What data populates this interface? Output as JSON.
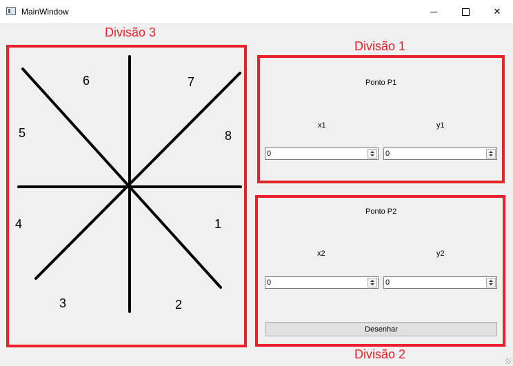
{
  "window": {
    "title": "MainWindow",
    "min_icon": "minimize-icon",
    "max_icon": "maximize-icon",
    "close_icon": "close-icon",
    "close_glyph": "✕"
  },
  "annotations": {
    "div3": "Divisão 3",
    "div1": "Divisão 1",
    "div2": "Divisão 2",
    "color": "#e8232b"
  },
  "octants": {
    "o1": "1",
    "o2": "2",
    "o3": "3",
    "o4": "4",
    "o5": "5",
    "o6": "6",
    "o7": "7",
    "o8": "8"
  },
  "p1": {
    "title": "Ponto P1",
    "x_label": "x1",
    "y_label": "y1",
    "x_value": "0",
    "y_value": "0"
  },
  "p2": {
    "title": "Ponto P2",
    "x_label": "x2",
    "y_label": "y2",
    "x_value": "0",
    "y_value": "0"
  },
  "draw_button": "Desenhar"
}
